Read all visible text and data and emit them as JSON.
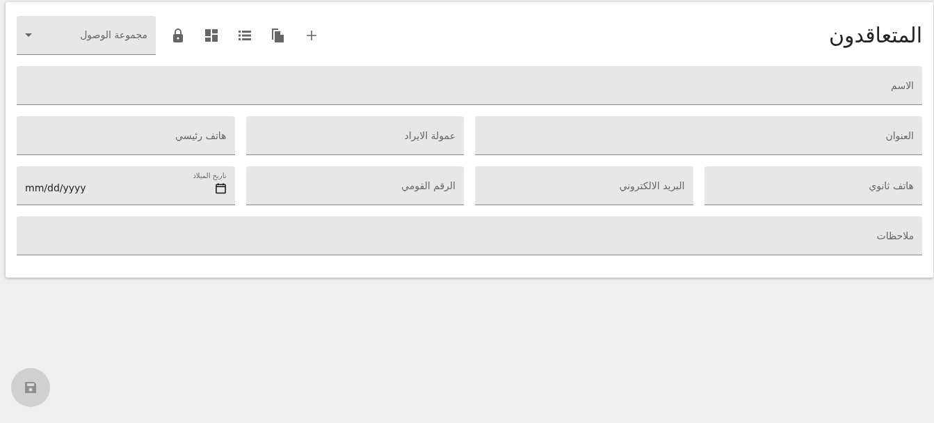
{
  "title": "المتعاقدون",
  "toolbar": [
    {
      "kind": "add"
    },
    {
      "kind": "copy"
    },
    {
      "kind": "list"
    },
    {
      "kind": "dashboard"
    },
    {
      "kind": "lock"
    }
  ],
  "access_group": {
    "placeholder": "مجموعة الوصول"
  },
  "rows": [
    [
      {
        "kind": "text",
        "placeholder": "الاسم"
      }
    ],
    [
      {
        "kind": "text",
        "placeholder": "العنوان"
      },
      {
        "kind": "text",
        "placeholder": "عمولة الايراد"
      },
      {
        "kind": "text",
        "placeholder": "هاتف رئيسي"
      }
    ],
    [
      {
        "kind": "text",
        "placeholder": "هاتف ثانوي"
      },
      {
        "kind": "text",
        "placeholder": "البريد الالكتروني"
      },
      {
        "kind": "text",
        "placeholder": "الرقم القومي"
      },
      {
        "kind": "date",
        "label": "تاريخ الميلاد",
        "placeholder": "mm/dd/yyyy"
      }
    ],
    [
      {
        "kind": "text",
        "placeholder": "ملاحظات"
      }
    ]
  ],
  "save_button": {
    "disabled": true
  }
}
